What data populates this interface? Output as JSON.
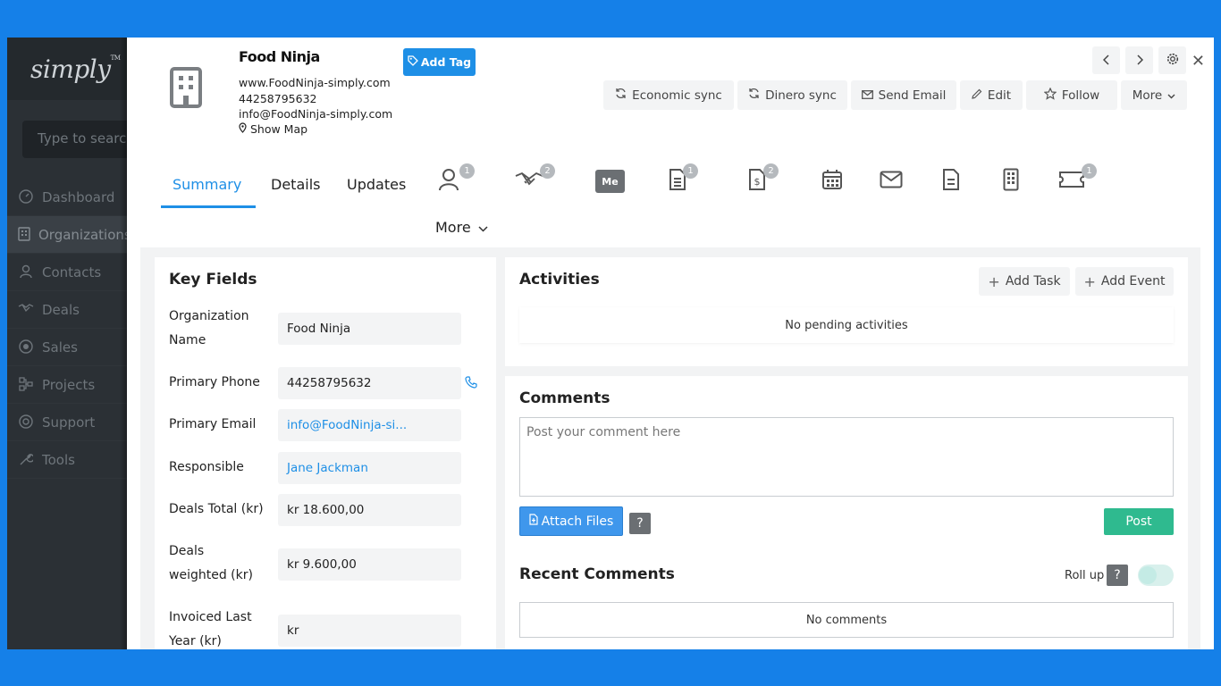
{
  "sidebar": {
    "logo": "simply",
    "search_placeholder": "Type to search",
    "items": [
      {
        "label": "Dashboard",
        "icon": "dashboard-icon"
      },
      {
        "label": "Organizations",
        "icon": "building-icon"
      },
      {
        "label": "Contacts",
        "icon": "person-icon"
      },
      {
        "label": "Deals",
        "icon": "handshake-icon"
      },
      {
        "label": "Sales",
        "icon": "sales-icon"
      },
      {
        "label": "Projects",
        "icon": "projects-icon"
      },
      {
        "label": "Support",
        "icon": "support-icon"
      },
      {
        "label": "Tools",
        "icon": "wrench-icon"
      }
    ]
  },
  "header": {
    "org_name": "Food Ninja",
    "website": "www.FoodNinja-simply.com",
    "phone": "44258795632",
    "email": "info@FoodNinja-simply.com",
    "show_map": "Show Map",
    "add_tag": "Add Tag",
    "actions": {
      "economic_sync": "Economic sync",
      "dinero_sync": "Dinero sync",
      "send_email": "Send Email",
      "edit": "Edit",
      "follow": "Follow",
      "more": "More"
    }
  },
  "tabs": {
    "summary": "Summary",
    "details": "Details",
    "updates": "Updates",
    "more": "More",
    "badges": {
      "contacts": "1",
      "deals": "2",
      "me": "Me",
      "documents": "1",
      "invoices": "2",
      "tickets": "1"
    }
  },
  "key_fields": {
    "title": "Key Fields",
    "rows": [
      {
        "label_l1": "Organization",
        "label_l2": "Name",
        "value": "Food Ninja"
      },
      {
        "label": "Primary Phone",
        "value": "44258795632"
      },
      {
        "label": "Primary Email",
        "value": "info@FoodNinja-si..."
      },
      {
        "label": "Responsible",
        "value": "Jane Jackman"
      },
      {
        "label": "Deals Total (kr)",
        "value": "kr 18.600,00"
      },
      {
        "label_l1": "Deals",
        "label_l2": "weighted (kr)",
        "value": "kr 9.600,00"
      },
      {
        "label_l1": "Invoiced Last",
        "label_l2": "Year (kr)",
        "value": "kr"
      }
    ]
  },
  "activities": {
    "title": "Activities",
    "add_task": "Add Task",
    "add_event": "Add Event",
    "empty": "No pending activities"
  },
  "comments": {
    "title": "Comments",
    "placeholder": "Post your comment here",
    "attach": "Attach Files",
    "help": "?",
    "post": "Post",
    "recent_title": "Recent Comments",
    "roll_up": "Roll up",
    "empty": "No comments"
  },
  "colors": {
    "accent": "#1e8fe6",
    "post": "#2fba8f",
    "sidebar": "#2b3035",
    "background": "#1580e8"
  }
}
